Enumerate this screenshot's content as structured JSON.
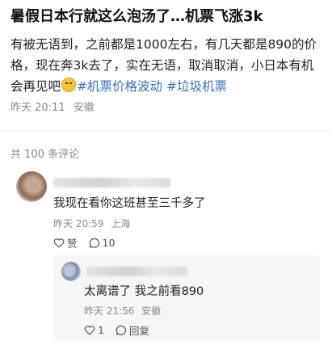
{
  "post": {
    "title": "暑假日本行就这么泡汤了…机票飞涨3k",
    "body_before_emoji": "有被无语到，之前都是1000左右，有几天都是890的价格，现在奔3k去了，实在无语，取消取消，小日本有机会再见吧",
    "emoji": "sad-face",
    "tags": [
      "#机票价格波动",
      "#垃圾机票"
    ],
    "time": "昨天 20:11",
    "location": "安徽"
  },
  "comments_header": {
    "count_text": "共 100 条评论"
  },
  "comment1": {
    "text": "我现在看你这班甚至三千多了",
    "time": "昨天 20:59",
    "location": "上海",
    "like_label": "赞",
    "reply_count": "10"
  },
  "reply1": {
    "text": "太离谱了 我之前看890",
    "time": "昨天 21:56",
    "location": "安徽",
    "like_count": "1",
    "reply_label": "回复"
  },
  "colors": {
    "tag": "#3b6fb6",
    "meta": "#8a8a8a"
  }
}
